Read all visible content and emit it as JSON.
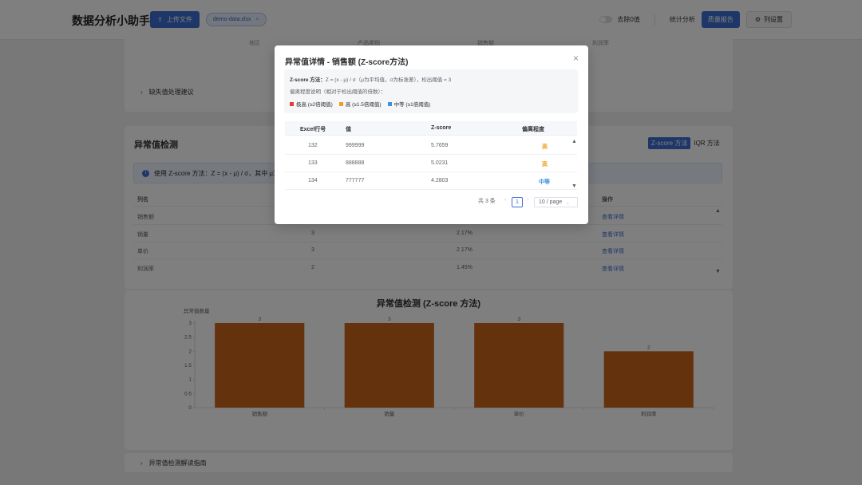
{
  "header": {
    "app_title": "数据分析小助手",
    "upload_label": "上传文件",
    "file_name": "demo-data.xlsx",
    "remove_zero_label": "去除0值",
    "stats_label": "统计分析",
    "quality_label": "质量报告",
    "settings_label": "列设置"
  },
  "top_section": {
    "faint_headers": [
      "地区",
      "产品类别",
      "销售额",
      "利润率"
    ],
    "missing_suggestion": "缺失值处理建议"
  },
  "outlier_section": {
    "title": "异常值检测",
    "tab_zscore": "Z-score 方法",
    "tab_iqr": "IQR 方法",
    "banner": "使用 Z-score 方法：Z = (x - μ) / σ，其中 μ为",
    "col_name": "列名",
    "col_action": "操作",
    "rows": [
      {
        "name": "销售额",
        "count": "",
        "pct": "",
        "action": "查看详情"
      },
      {
        "name": "销量",
        "count": "3",
        "pct": "2.17%",
        "action": "查看详情"
      },
      {
        "name": "单价",
        "count": "3",
        "pct": "2.17%",
        "action": "查看详情"
      },
      {
        "name": "利润率",
        "count": "2",
        "pct": "1.45%",
        "action": "查看详情"
      }
    ],
    "guide": "异常值检测解读指南"
  },
  "chart_data": {
    "type": "bar",
    "title": "异常值检测 (Z-score 方法)",
    "ylabel": "异常值数量",
    "xlabel": "",
    "categories": [
      "销售额",
      "销量",
      "单价",
      "利润率"
    ],
    "values": [
      3,
      3,
      3,
      2
    ],
    "ylim": [
      0,
      3
    ],
    "yticks": [
      "0",
      "0.5",
      "1",
      "1.5",
      "2",
      "2.5",
      "3"
    ],
    "data_labels": [
      "3",
      "3",
      "3",
      "2"
    ],
    "bar_color": "#c8651b",
    "grid": false
  },
  "modal": {
    "title": "异常值详情 - 销售额 (Z-score方法)",
    "close_icon": "×",
    "formula_label": "Z-score 方法：",
    "formula_text": "Z = (x - μ) / σ（μ为平均值，σ为标准差），检出阈值 = 3",
    "desc": "偏离程度说明（相对于检出阈值的倍数）：",
    "legend": [
      {
        "label": "极高 (≥2倍阈值)",
        "color": "#e03b3b"
      },
      {
        "label": "高 (≥1.5倍阈值)",
        "color": "#f0a020"
      },
      {
        "label": "中等 (≥1倍阈值)",
        "color": "#3f8fe0"
      }
    ],
    "columns": [
      "Excel行号",
      "值",
      "Z-score",
      "偏离程度"
    ],
    "rows": [
      {
        "row": "132",
        "value": "999999",
        "z": "5.7659",
        "level": "高",
        "level_color": "#f0a020"
      },
      {
        "row": "133",
        "value": "888888",
        "z": "5.0231",
        "level": "高",
        "level_color": "#f0a020"
      },
      {
        "row": "134",
        "value": "777777",
        "z": "4.2803",
        "level": "中等",
        "level_color": "#3f8fe0"
      }
    ],
    "total": "共 3 条",
    "current_page": "1",
    "page_size": "10 / page"
  }
}
